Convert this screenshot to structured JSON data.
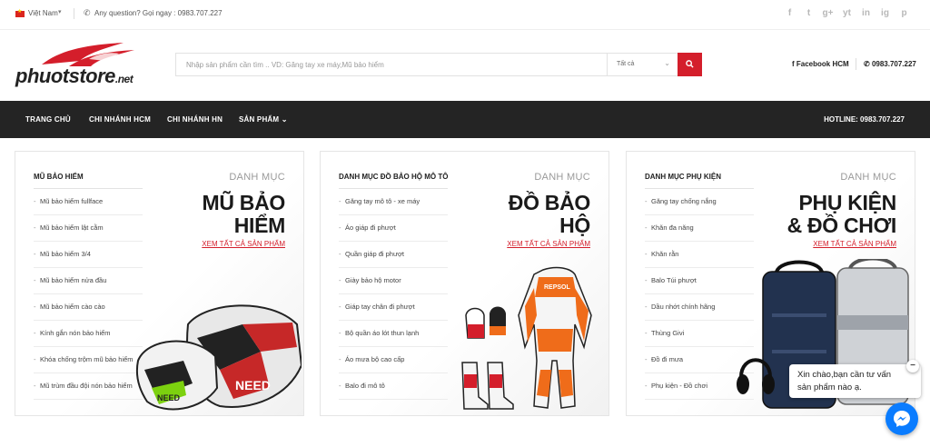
{
  "topbar": {
    "language": "Việt Nam",
    "question": "Any question? Gọi ngay : 0983.707.227",
    "socials": [
      "f",
      "t",
      "g+",
      "yt",
      "in",
      "ig",
      "p"
    ],
    "social_icons": [
      "facebook-icon",
      "twitter-icon",
      "google-plus-icon",
      "youtube-icon",
      "linkedin-icon",
      "instagram-icon",
      "pinterest-icon"
    ]
  },
  "header": {
    "logo_text": "phuotstore",
    "logo_suffix": ".net",
    "search_placeholder": "Nhập sản phẩm cần tìm .. VD: Găng tay xe máy,Mũ bảo hiểm",
    "search_category": "Tất cả",
    "facebook_label": "Facebook HCM",
    "phone_label": "0983.707.227"
  },
  "nav": {
    "items": [
      "TRANG CHỦ",
      "CHI NHÁNH HCM",
      "CHI NHÁNH HN",
      "SẢN PHẨM"
    ],
    "hotline": "HOTLINE: 0983.707.227"
  },
  "panels": [
    {
      "title": "MŨ BẢO HIỂM",
      "label": "DANH MỤC",
      "big_title_1": "MŨ BẢO",
      "big_title_2": "HIỂM",
      "see_all": "XEM TẤT CẢ SẢN PHẨM",
      "items": [
        "Mũ bảo hiểm fullface",
        "Mũ bảo hiểm lật cằm",
        "Mũ bảo hiểm 3/4",
        "Mũ bảo hiểm nửa đầu",
        "Mũ bảo hiểm cào cào",
        "Kính gắn nón bảo hiểm",
        "Khóa chống trộm mũ bảo hiểm",
        "Mũ trùm đầu đội nón bảo hiểm"
      ]
    },
    {
      "title": "DANH MỤC ĐỒ BẢO HỘ MÔ TÔ",
      "label": "DANH MỤC",
      "big_title_1": "ĐỒ BẢO",
      "big_title_2": "HỘ",
      "see_all": "XEM TẤT CẢ SẢN PHẨM",
      "items": [
        "Găng tay mô tô - xe máy",
        "Áo giáp đi phượt",
        "Quần giáp đi phượt",
        "Giày bảo hộ motor",
        "Giáp tay chân đi phượt",
        "Bộ quần áo lót thun lạnh",
        "Áo mưa bộ cao cấp",
        "Balo đi mô tô"
      ]
    },
    {
      "title": "DANH MỤC PHỤ KIỆN",
      "label": "DANH MỤC",
      "big_title_1": "PHỤ KIỆN",
      "big_title_2": "& ĐỒ CHƠI",
      "see_all": "XEM TẤT CẢ SẢN PHẨM",
      "items": [
        "Găng tay chống nắng",
        "Khăn đa năng",
        "Khăn rằn",
        "Balo Túi phượt",
        "Dầu nhớt chính hãng",
        "Thùng Givi",
        "Đồ đi mưa",
        "Phụ kiện - Đồ chơi"
      ]
    }
  ],
  "chat": {
    "line1": "Xin chào,bạn cần tư vấn",
    "line2": "sản phẩm nào ạ.",
    "close": "−"
  },
  "colors": {
    "accent": "#d41e2b",
    "nav_bg": "#242424",
    "messenger": "#0a7cff"
  }
}
